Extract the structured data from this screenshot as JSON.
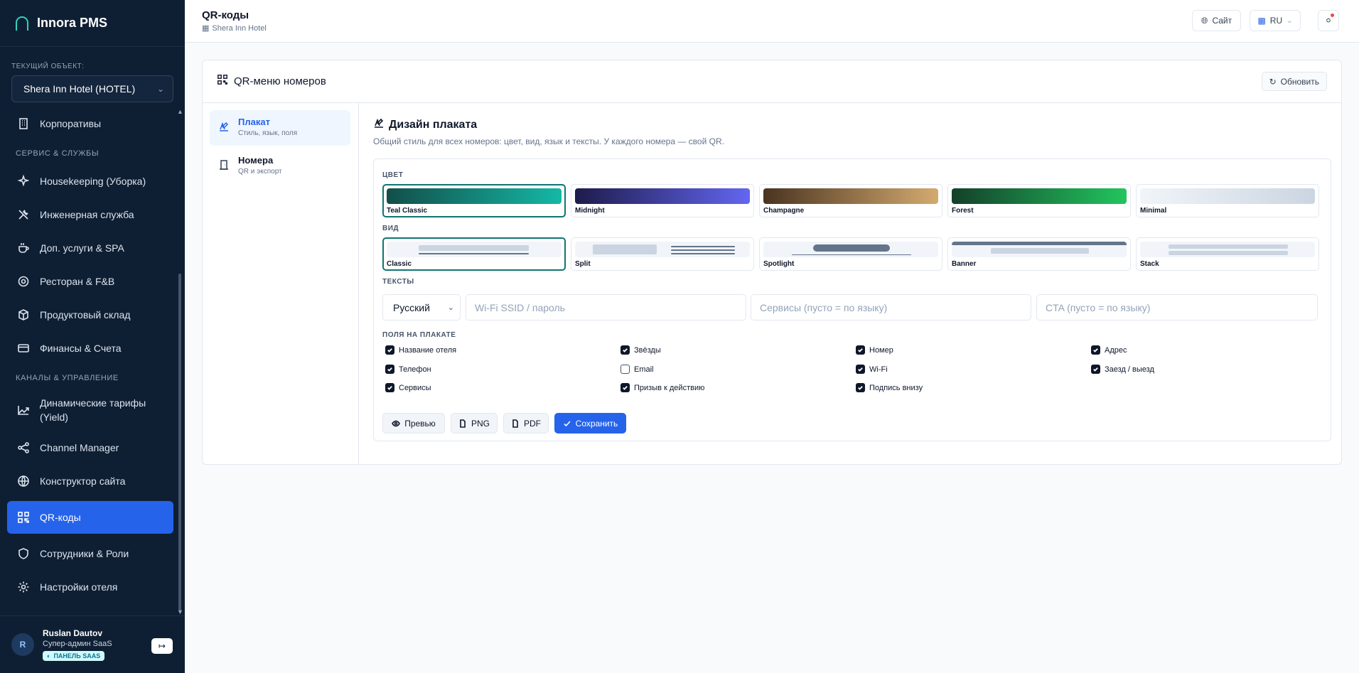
{
  "brand": {
    "name": "Innora PMS"
  },
  "object": {
    "label": "Текущий объект:",
    "value": "Shera Inn Hotel (HOTEL)"
  },
  "nav": {
    "corporates": "Корпоративы",
    "section_service": "Сервис & службы",
    "housekeeping": "Housekeeping (Уборка)",
    "engineering": "Инженерная служба",
    "extras": "Доп. услуги & SPA",
    "restaurant": "Ресторан & F&B",
    "warehouse": "Продуктовый склад",
    "finance": "Финансы & Счета",
    "section_channels": "Каналы & управление",
    "yield": "Динамические тарифы (Yield)",
    "channel_manager": "Channel Manager",
    "site_builder": "Конструктор сайта",
    "qr": "QR-коды",
    "staff": "Сотрудники & Роли",
    "settings": "Настройки отеля"
  },
  "user": {
    "initial": "R",
    "name": "Ruslan Dautov",
    "role": "Супер-админ SaaS",
    "badge": "ПАНЕЛЬ SAAS"
  },
  "header": {
    "title": "QR-коды",
    "subtitle": "Shera Inn Hotel",
    "site_btn": "Сайт",
    "lang_btn": "RU"
  },
  "card": {
    "title": "QR-меню номеров",
    "refresh": "Обновить"
  },
  "tabs": [
    {
      "label": "Плакат",
      "sub": "Стиль, язык, поля"
    },
    {
      "label": "Номера",
      "sub": "QR и экспорт"
    }
  ],
  "design": {
    "title": "Дизайн плаката",
    "desc": "Общий стиль для всех номеров: цвет, вид, язык и тексты. У каждого номера — свой QR.",
    "color_label": "Цвет",
    "layout_label": "Вид",
    "texts_label": "Тексты",
    "fields_label": "Поля на плакате"
  },
  "colors": [
    {
      "name": "Teal Classic",
      "from": "#134e4a",
      "to": "#14b8a6",
      "selected": true
    },
    {
      "name": "Midnight",
      "from": "#1e1b4b",
      "to": "#6366f1",
      "selected": false
    },
    {
      "name": "Champagne",
      "from": "#4a3420",
      "to": "#d4aa70",
      "selected": false
    },
    {
      "name": "Forest",
      "from": "#14402a",
      "to": "#22c55e",
      "selected": false
    },
    {
      "name": "Minimal",
      "from": "#f1f5f9",
      "to": "#cbd5e1",
      "selected": false
    }
  ],
  "layouts": [
    {
      "name": "Classic",
      "selected": true
    },
    {
      "name": "Split",
      "selected": false
    },
    {
      "name": "Spotlight",
      "selected": false
    },
    {
      "name": "Banner",
      "selected": false
    },
    {
      "name": "Stack",
      "selected": false
    }
  ],
  "texts": {
    "language": "Русский",
    "wifi_placeholder": "Wi-Fi SSID / пароль",
    "services_placeholder": "Сервисы (пусто = по языку)",
    "cta_placeholder": "CTA (пусто = по языку)"
  },
  "fields": [
    {
      "label": "Название отеля",
      "checked": true
    },
    {
      "label": "Звёзды",
      "checked": true
    },
    {
      "label": "Номер",
      "checked": true
    },
    {
      "label": "Адрес",
      "checked": true
    },
    {
      "label": "Телефон",
      "checked": true
    },
    {
      "label": "Email",
      "checked": false
    },
    {
      "label": "Wi-Fi",
      "checked": true
    },
    {
      "label": "Заезд / выезд",
      "checked": true
    },
    {
      "label": "Сервисы",
      "checked": true
    },
    {
      "label": "Призыв к действию",
      "checked": true
    },
    {
      "label": "Подпись внизу",
      "checked": true
    }
  ],
  "actions": {
    "preview": "Превью",
    "png": "PNG",
    "pdf": "PDF",
    "save": "Сохранить"
  }
}
